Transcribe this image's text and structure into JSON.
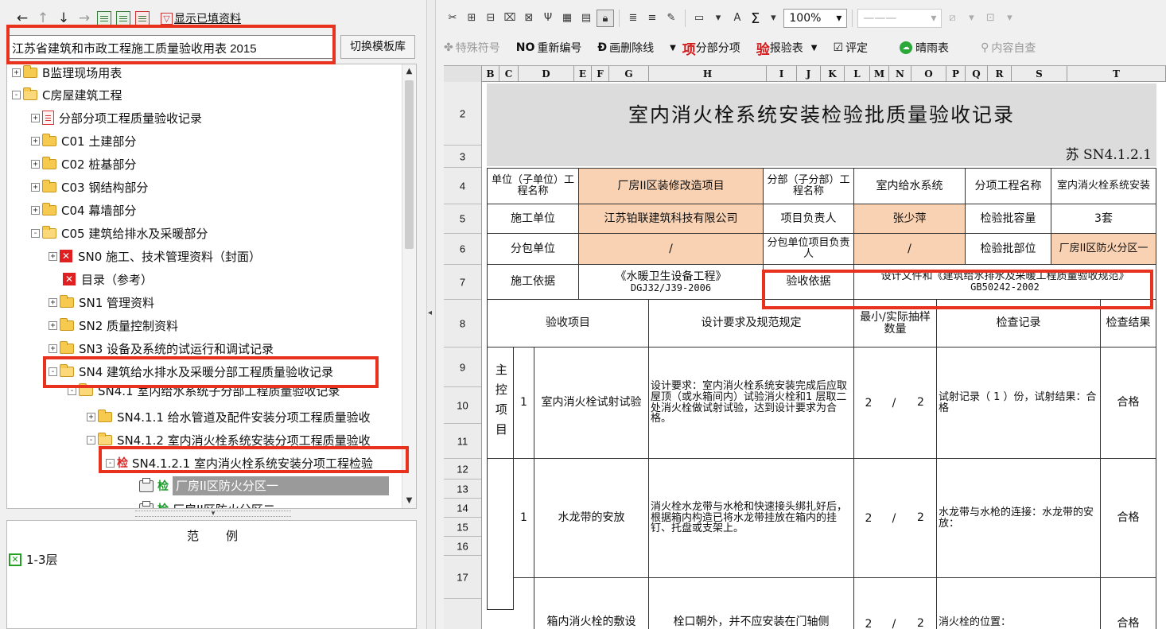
{
  "left_toolbar": {
    "show_filled_label": "显示已填资料"
  },
  "template": {
    "value": "江苏省建筑和市政工程施工质量验收用表 2015",
    "switch_button": "切换模板库"
  },
  "tree": {
    "items": [
      {
        "label": "B监理现场用表"
      },
      {
        "label": "C房屋建筑工程"
      },
      {
        "label": "分部分项工程质量验收记录"
      },
      {
        "label": "C01 土建部分"
      },
      {
        "label": "C02 桩基部分"
      },
      {
        "label": "C03 钢结构部分"
      },
      {
        "label": "C04 幕墙部分"
      },
      {
        "label": "C05 建筑给排水及采暖部分"
      },
      {
        "label": "SN0 施工、技术管理资料（封面）"
      },
      {
        "label": "目录（参考）"
      },
      {
        "label": "SN1 管理资料"
      },
      {
        "label": "SN2 质量控制资料"
      },
      {
        "label": "SN3 设备及系统的试运行和调试记录"
      },
      {
        "label": "SN4 建筑给水排水及采暖分部工程质量验收记录"
      },
      {
        "label": "SN4.1 室内给水系统子分部工程质量验收记录"
      },
      {
        "label": "SN4.1.1 给水管道及配件安装分项工程质量验收"
      },
      {
        "label": "SN4.1.2 室内消火栓系统安装分项工程质量验收"
      },
      {
        "label": "SN4.1.2.1 室内消火栓系统安装分项工程检验"
      },
      {
        "label": "厂房II区防火分区一"
      },
      {
        "label": "厂房II区防火分区二"
      }
    ],
    "jian_char": "检"
  },
  "legend": {
    "title": "范例",
    "item_label": "1-3层"
  },
  "toolbar1": {
    "zoom": "100%"
  },
  "toolbar2": {
    "special_symbol": "特殊符号",
    "renumber_mark": "NO",
    "renumber": "重新编号",
    "strike_mark": "Ð",
    "strike": "画删除线",
    "item_mark": "项",
    "subitem": "分部分项",
    "inspect_mark": "验",
    "inspect": "报验表",
    "evaluate": "评定",
    "weather": "晴雨表",
    "content_self": "内容自查"
  },
  "sheet": {
    "columns": [
      "B",
      "C",
      "D",
      "E",
      "F",
      "G",
      "H",
      "I",
      "J",
      "K",
      "L",
      "M",
      "N",
      "O",
      "P",
      "Q",
      "R",
      "S",
      "T"
    ],
    "rows": [
      "2",
      "3",
      "4",
      "5",
      "6",
      "7",
      "8",
      "9",
      "10",
      "11",
      "12",
      "13",
      "14",
      "15",
      "16",
      "17"
    ],
    "title": "室内消火栓系统安装检验批质量验收记录",
    "code": "苏 SN4.1.2.1",
    "unit_label": "单位（子单位）工程名称",
    "unit_value": "厂房II区装修改造项目",
    "division_label": "分部（子分部）工程名称",
    "division_value": "室内给水系统",
    "subitem_label": "分项工程名称",
    "subitem_value": "室内消火栓系统安装",
    "contractor_label": "施工单位",
    "contractor_value": "江苏铂联建筑科技有限公司",
    "pm_label": "项目负责人",
    "pm_value": "张少萍",
    "capacity_label": "检验批容量",
    "capacity_value": "3套",
    "sub_label": "分包单位",
    "sub_value": "/",
    "sub_pm_label": "分包单位项目负责人",
    "sub_pm_value": "/",
    "part_label": "检验批部位",
    "part_value": "厂房II区防火分区一",
    "basis_label": "施工依据",
    "basis_value_1": "《水暖卫生设备工程》",
    "basis_value_2": "DGJ32/J39-2006",
    "accept_basis_label": "验收依据",
    "accept_basis_value_1": "设计文件和《建筑给水排水及采暖工程质量验收规范》",
    "accept_basis_value_2": "GB50242-2002",
    "hdr_item": "验收项目",
    "hdr_req": "设计要求及规范规定",
    "hdr_sample": "最小/实际抽样数量",
    "hdr_record": "检查记录",
    "hdr_result": "检查结果",
    "main_ctrl": "主控项目",
    "r1_no": "1",
    "r1_item": "室内消火栓试射试验",
    "r1_req": "设计要求：室内消火栓系统安装完成后应取屋顶（或水箱间内）试验消火栓和1 层取二处消火栓做试射试验，达到设计要求为合格。",
    "r1_min": "2",
    "r1_slash": "/",
    "r1_act": "2",
    "r1_record": "试射记录（ 1 ）份，试射结果：合格",
    "r1_result": "合格",
    "r2_no": "1",
    "r2_item": "水龙带的安放",
    "r2_req": "消火栓水龙带与水枪和快速接头绑扎好后，根据箱内构造已将水龙带挂放在箱内的挂钉、托盘或支架上。",
    "r2_min": "2",
    "r2_slash": "/",
    "r2_act": "2",
    "r2_record": "水龙带与水枪的连接：水龙带的安放：",
    "r2_result": "合格",
    "r3_item": "箱内消火栓的敷设",
    "r3_req": "栓口朝外，并不应安装在门轴侧",
    "r3_min": "2",
    "r3_slash": "/",
    "r3_act": "2",
    "r3_record": "消火栓的位置：",
    "r3_result": "合格"
  },
  "highlight_color": "#e8321e"
}
